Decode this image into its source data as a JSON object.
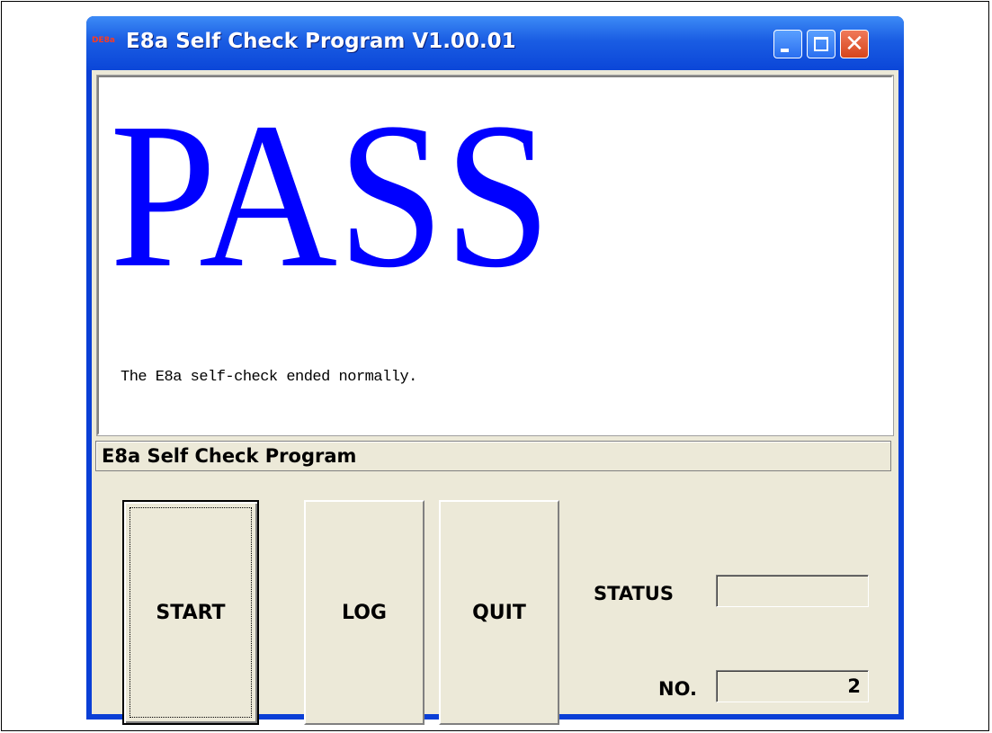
{
  "window": {
    "title": "E8a Self Check Program V1.00.01",
    "icon_text": "DE8a",
    "icon": "app-icon",
    "controls": [
      "minimize-icon",
      "maximize-icon",
      "close-icon"
    ],
    "close_glyph": "✕"
  },
  "display": {
    "result": "PASS",
    "result_color": "#0000ff",
    "message": "The E8a self-check ended normally."
  },
  "statusbar": {
    "text": "E8a Self Check Program"
  },
  "buttons": {
    "start": "START",
    "log": "LOG",
    "quit": "QUIT"
  },
  "info": {
    "status_label": "STATUS",
    "status_value": "",
    "no_label": "NO.",
    "no_value": "2"
  }
}
